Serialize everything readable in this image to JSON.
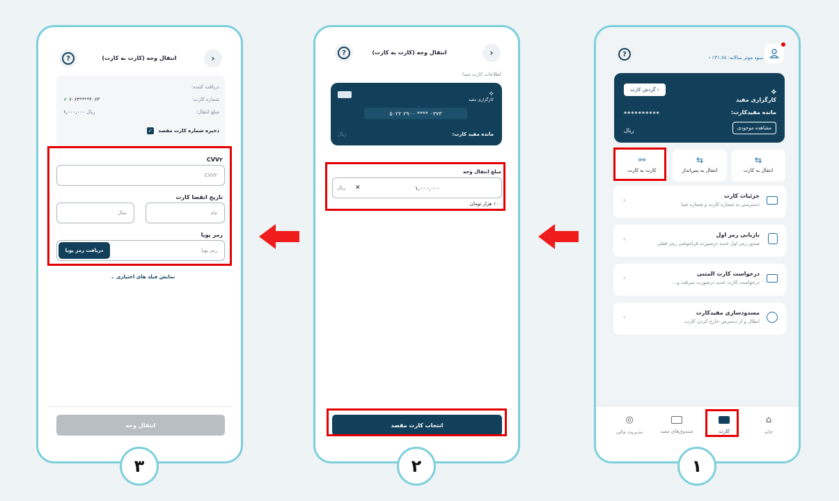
{
  "step_numbers": [
    "۱",
    "۲",
    "۳"
  ],
  "screen1": {
    "profit_text": "سود موثر سالانه: ۳۱.۷۸٪",
    "card_turnover_button": "گردش کارت",
    "brand": "کارگزاری مفید",
    "balance_label": "مانده مفیدکارت:",
    "balance_masked": "**********",
    "view_balance_button": "مشاهده موجودی",
    "currency": "ریال",
    "quick_actions": [
      "انتقال به کارت",
      "انتقال به پس‌انداز",
      "کارت به کارت"
    ],
    "menu": [
      {
        "title": "جزئیات کارت",
        "subtitle": "دسترسی به شماره کارت و شماره شبا",
        "icon": "card-icon"
      },
      {
        "title": "بازیابی رمز اول",
        "subtitle": "صدور رمز اول جدید درصورت فراموشی رمز فعلی",
        "icon": "lock-icon"
      },
      {
        "title": "درخواست کارت المثنی",
        "subtitle": "درخواست کارت جدید درصورت سرقت و...",
        "icon": "card-duplicate-icon"
      },
      {
        "title": "مسدودسازی مفیدکارت",
        "subtitle": "ابطال و از دسترس خارج کردن کارت",
        "icon": "fingerprint-icon"
      }
    ],
    "tabs": [
      "خانه",
      "کارت",
      "صندوق‌های مفید",
      "مدیریت مالی"
    ]
  },
  "screen2": {
    "title": "انتقال وجه (کارت به کارت)",
    "source_label": "اطلاعات کارت مبدا",
    "brand": "کارگزاری مفید",
    "card_number": "۵۰۲۲ ۲۹۰۰ **** ۰۳۷۳",
    "balance_label": "مانده مفید کارت:",
    "currency": "ریال",
    "amount_label": "مبلغ انتقال وجه",
    "amount_value": "۱,۰۰۰,۰۰۰",
    "amount_unit": "ریال",
    "amount_words": "۱۰۰ هزار تومان",
    "clear_symbol": "✕",
    "select_dest_button": "انتخاب کارت مقصد"
  },
  "screen3": {
    "title": "انتقال وجه (کارت به کارت)",
    "receiver_label": "دریافت کننده:",
    "card_number_label": "شماره کارت:",
    "card_number_value": "۶۰۶۳****۲۰۶۳",
    "amount_label": "مبلغ انتقال:",
    "amount_value": "۱,۰۰۰,۰۰۰",
    "amount_currency": "ریال",
    "save_dest_label": "ذخیره شماره کارت مقصد",
    "cvv_label": "CVV۲",
    "cvv_placeholder": "CVV۲",
    "expiry_label": "تاریخ انقضا کارت",
    "month_placeholder": "ماه",
    "year_placeholder": "سال",
    "dynamic_pin_label": "رمز پویا",
    "dynamic_pin_placeholder": "رمز پویا",
    "get_pin_button": "دریافت رمز پویا",
    "optional_fields_link": "نمایش فیلد های اختیاری",
    "transfer_button": "انتقال وجه"
  }
}
